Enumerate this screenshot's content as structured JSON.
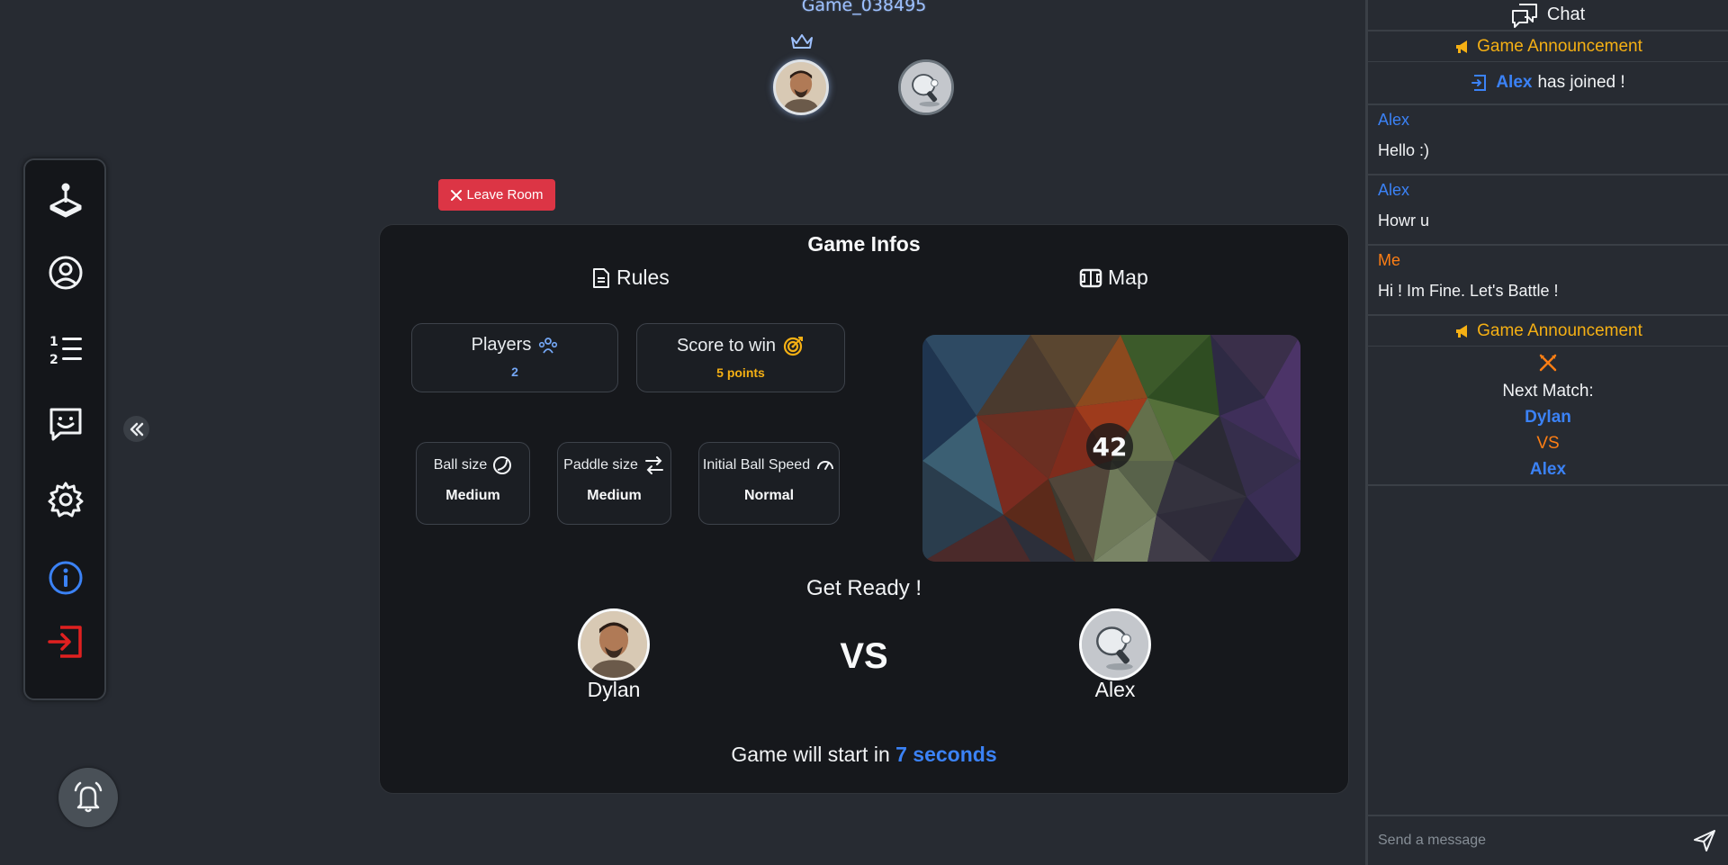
{
  "room": {
    "name": "Game_038495"
  },
  "leave_button": {
    "label": "Leave Room"
  },
  "panel": {
    "title": "Game Infos",
    "rules_label": "Rules",
    "map_label": "Map",
    "players": {
      "label": "Players",
      "value": "2"
    },
    "score": {
      "label": "Score to win",
      "value": "5 points"
    },
    "ball_size": {
      "label": "Ball size",
      "value": "Medium"
    },
    "paddle_size": {
      "label": "Paddle size",
      "value": "Medium"
    },
    "ball_speed": {
      "label": "Initial Ball Speed",
      "value": "Normal"
    },
    "map_logo": "42",
    "ready_text": "Get Ready !",
    "player1": "Dylan",
    "player2": "Alex",
    "vs": "VS",
    "countdown_prefix": "Game will start in",
    "countdown_value": "7 seconds"
  },
  "sidebar": {
    "items": [
      "game-icon",
      "profile-icon",
      "leaderboard-icon",
      "chat-icon",
      "settings-icon",
      "info-icon",
      "logout-icon"
    ]
  },
  "chat": {
    "title": "Chat",
    "announcement_label": "Game Announcement",
    "join": {
      "user": "Alex",
      "text": "has joined !"
    },
    "messages": [
      {
        "author": "Alex",
        "text": "Hello :)"
      },
      {
        "author": "Alex",
        "text": "Howr u"
      },
      {
        "author": "Me",
        "text": "Hi ! Im Fine. Let's Battle !"
      }
    ],
    "next_match": {
      "title": "Next Match:",
      "player1": "Dylan",
      "vs": "VS",
      "player2": "Alex"
    },
    "input_placeholder": "Send a message"
  },
  "colors": {
    "accent_blue": "#3b82f6",
    "announce_yellow": "#f5b014",
    "me_orange": "#fd7e14",
    "danger": "#dc3545"
  }
}
